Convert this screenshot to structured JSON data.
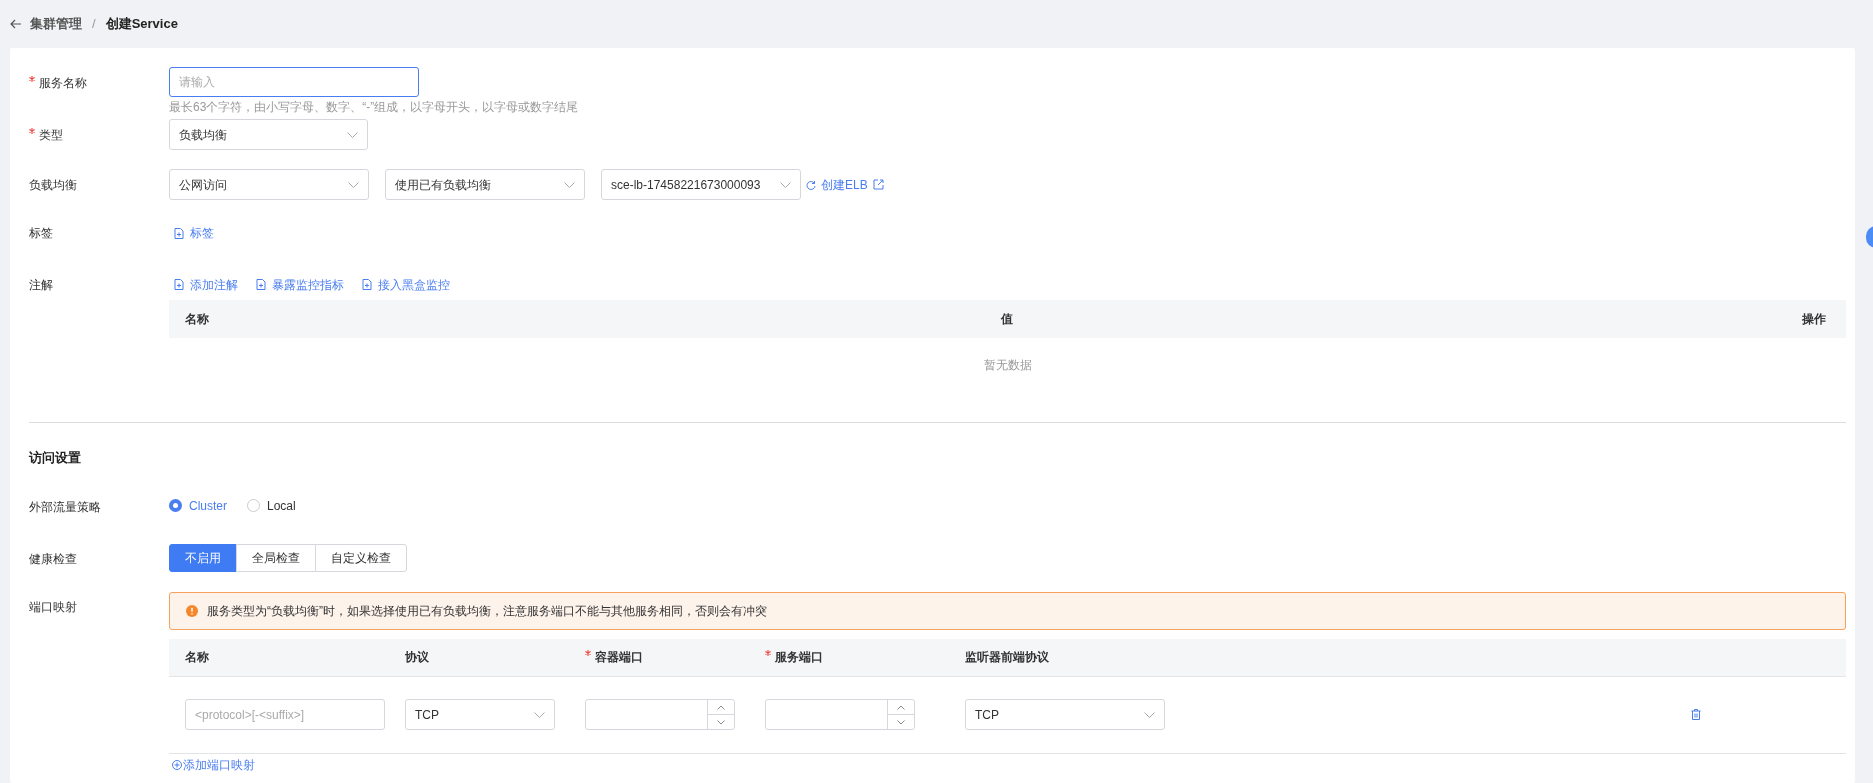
{
  "breadcrumb": {
    "items": [
      "集群管理",
      "创建Service"
    ],
    "separator": "/"
  },
  "form": {
    "service_name": {
      "label": "服务名称",
      "required": true,
      "placeholder": "请输入",
      "hint": "最长63个字符，由小写字母、数字、“-”组成，以字母开头，以字母或数字结尾"
    },
    "type": {
      "label": "类型",
      "required": true,
      "value": "负载均衡"
    },
    "load_balancer": {
      "label": "负载均衡",
      "required": false,
      "selects": [
        "公网访问",
        "使用已有负载均衡",
        "sce-lb-17458221673000093"
      ],
      "create_link": "创建ELB"
    },
    "tags": {
      "label": "标签",
      "link": "标签"
    },
    "annotations": {
      "label": "注解",
      "links": [
        "添加注解",
        "暴露监控指标",
        "接入黑盒监控"
      ],
      "table": {
        "columns": [
          "名称",
          "值",
          "操作"
        ],
        "empty_text": "暂无数据"
      }
    }
  },
  "access_settings": {
    "title": "访问设置",
    "traffic_policy": {
      "label": "外部流量策略",
      "options": [
        {
          "label": "Cluster",
          "selected": true
        },
        {
          "label": "Local",
          "selected": false
        }
      ]
    },
    "health_check": {
      "label": "健康检查",
      "options": [
        {
          "label": "不启用",
          "selected": true
        },
        {
          "label": "全局检查",
          "selected": false
        },
        {
          "label": "自定义检查",
          "selected": false
        }
      ]
    },
    "port_mapping": {
      "label": "端口映射",
      "alert": "服务类型为“负载均衡”时，如果选择使用已有负载均衡，注意服务端口不能与其他服务相同，否则会有冲突",
      "columns": [
        {
          "label": "名称",
          "required": false
        },
        {
          "label": "协议",
          "required": false
        },
        {
          "label": "容器端口",
          "required": true
        },
        {
          "label": "服务端口",
          "required": true
        },
        {
          "label": "监听器前端协议",
          "required": false
        }
      ],
      "rows": [
        {
          "name_placeholder": "<protocol>[-<suffix>]",
          "protocol": "TCP",
          "listener_protocol": "TCP"
        }
      ],
      "add_link": "添加端口映射"
    }
  }
}
